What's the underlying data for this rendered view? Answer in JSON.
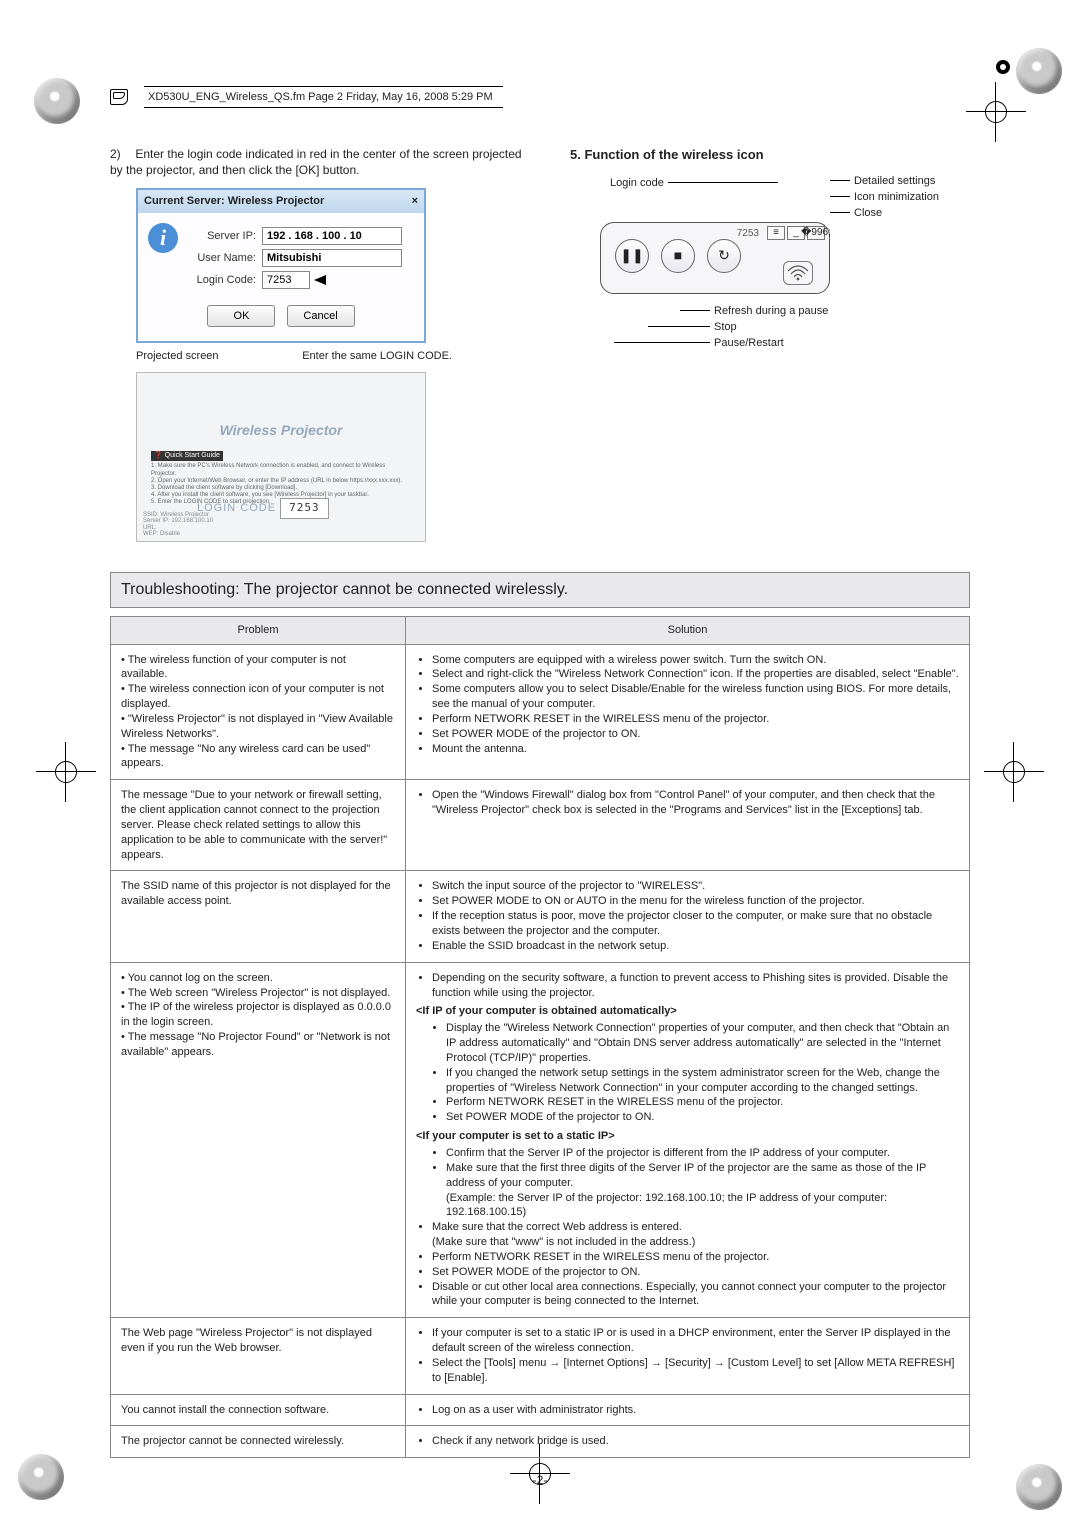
{
  "header": {
    "filename": "XD530U_ENG_Wireless_QS.fm  Page 2  Friday, May 16, 2008  5:29 PM"
  },
  "step": {
    "num": "2)",
    "text": "Enter the login code indicated in red in the center of the screen projected by the projector, and then click the [OK] button."
  },
  "dialog": {
    "title": "Current Server: Wireless Projector",
    "close": "×",
    "server_ip_label": "Server IP:",
    "server_ip": "192 . 168 . 100 . 10",
    "user_label": "User Name:",
    "user": "Mitsubishi",
    "code_label": "Login Code:",
    "code": "7253",
    "ok": "OK",
    "cancel": "Cancel"
  },
  "caption": {
    "left": "Projected screen",
    "right": "Enter the same LOGIN CODE."
  },
  "proj": {
    "title": "Wireless Projector",
    "qsg_head": "Quick Start Guide",
    "qsg_body": "1. Make sure the PC's Wireless Network connection is enabled, and connect to Wireless Projector.\n2. Open your Internet/Web Browser, or enter the IP address (URL in below https://xxx.xxx.xxx).\n3. Download the client software by clicking [Download].\n4. After you install the client software, you see [Wireless Projector] in your taskbar.\n5. Enter the LOGIN CODE to start projection.",
    "login_label": "LOGIN CODE",
    "login_code": "7253",
    "foot1": "SSID: Wireless Projector",
    "foot2": "Server IP: 192.168.100.10",
    "foot3": "URL:",
    "foot4": "WEP: Disable"
  },
  "section5": {
    "title": "5.  Function of the wireless icon",
    "labels": {
      "login_code": "Login code",
      "detailed": "Detailed settings",
      "min": "Icon minimization",
      "close": "Close",
      "refresh": "Refresh during a pause",
      "stop": "Stop",
      "pause": "Pause/Restart",
      "tray_code": "7253"
    }
  },
  "ts": {
    "title": "Troubleshooting: The projector cannot be connected wirelessly.",
    "head_problem": "Problem",
    "head_solution": "Solution",
    "rows": [
      {
        "p": "• The wireless function of your computer is not available.\n• The wireless connection icon of your computer is not displayed.\n• \"Wireless Projector\" is not displayed in \"View Available Wireless Networks\".\n• The message \"No any wireless card can be used\" appears.",
        "s": [
          "Some computers are equipped with a wireless power switch. Turn the switch ON.",
          "Select and right-click the \"Wireless Network Connection\" icon. If the properties are disabled, select \"Enable\".",
          "Some computers allow you to select Disable/Enable for the wireless function using BIOS. For more details, see the manual of your computer.",
          "Perform NETWORK RESET in the WIRELESS menu of the projector.",
          "Set POWER MODE of the projector to ON.",
          "Mount the antenna."
        ]
      },
      {
        "p": "The message \"Due to your network or firewall setting, the client application cannot connect to the projection server. Please check related settings to allow this application to be able to communicate with the server!\" appears.",
        "s": [
          "Open the \"Windows Firewall\" dialog box from \"Control Panel\" of your computer, and then check that the \"Wireless Projector\" check box is selected in the \"Programs and Services\" list in the [Exceptions] tab."
        ]
      },
      {
        "p": "The SSID name of this projector is not displayed for the available access point.",
        "s": [
          "Switch the input source of the projector to \"WIRELESS\".",
          "Set POWER MODE to ON or AUTO in the menu for the wireless function of the projector.",
          "If the reception status is poor, move the projector closer to the computer, or make sure that no obstacle exists between the projector and the computer.",
          "Enable the SSID broadcast in the network setup."
        ]
      },
      {
        "p": "• You cannot log on the screen.\n• The Web screen \"Wireless Projector\" is not displayed.\n• The IP of the wireless projector is displayed as 0.0.0.0 in the login screen.\n• The message \"No Projector Found\" or \"Network is not available\" appears.",
        "s_custom": "row4"
      },
      {
        "p": "The Web page \"Wireless Projector\" is not displayed even if you run the Web browser.",
        "s": [
          "If your computer is set to a static IP or is used in a DHCP environment, enter the Server IP displayed in the default screen of the wireless connection.",
          "Select the [Tools] menu → [Internet Options] → [Security] → [Custom Level] to set [Allow META REFRESH] to [Enable]."
        ]
      },
      {
        "p": "You cannot install the connection software.",
        "s": [
          "Log on as a user with administrator rights."
        ]
      },
      {
        "p": "The projector cannot be connected wirelessly.",
        "s": [
          "Check if any network bridge is used."
        ]
      }
    ],
    "row4": {
      "top": "Depending on the security software, a function to prevent access to Phishing sites is provided. Disable the function while using the projector.",
      "auto_head": "<If IP of your computer is obtained automatically>",
      "auto": [
        "Display the \"Wireless Network Connection\" properties of your computer, and then check that \"Obtain an IP address automatically\" and \"Obtain DNS server address automatically\" are selected in the \"Internet Protocol (TCP/IP)\" properties.",
        "If you changed the network setup settings in the system administrator screen for the Web, change the properties of \"Wireless Network Connection\" in your computer according to the changed settings.",
        "Perform NETWORK RESET in the WIRELESS menu of the projector.",
        "Set POWER MODE of the projector to ON."
      ],
      "static_head": "<If your computer is set to a static IP>",
      "static": [
        "Confirm that the Server IP of the projector is different from the IP address of your computer.",
        "Make sure that the first three digits of the Server IP of the projector are the same as those of the IP address of your computer.\n(Example: the Server IP of the projector: 192.168.100.10; the IP address of your computer: 192.168.100.15)"
      ],
      "tail": [
        "Make sure that the correct Web address is entered.\n(Make sure that \"www\" is not included in the address.)",
        "Perform NETWORK RESET in the WIRELESS menu of the projector.",
        "Set POWER MODE of the projector to ON.",
        "Disable or cut other local area connections. Especially, you cannot connect your computer to the projector while your computer is being connected to the Internet."
      ]
    }
  },
  "page_number": "-2-"
}
